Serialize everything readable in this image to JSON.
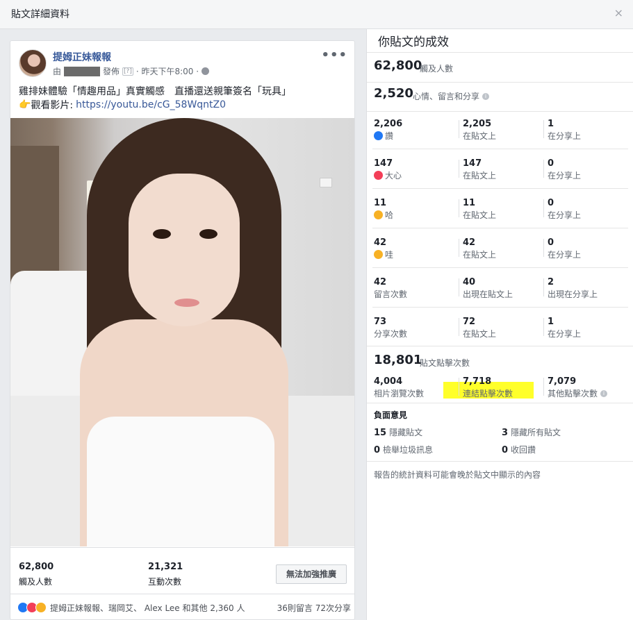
{
  "dialog": {
    "title": "貼文詳細資料",
    "close": "×"
  },
  "post": {
    "page_name": "提姆正妹報報",
    "meta": {
      "prefix": "由",
      "published": "發佈",
      "help": "[?]",
      "time": "· 昨天下午8:00 ·"
    },
    "more": "•••",
    "text_line1": "雞排妹體驗「情趣用品」真實觸感　直播還送親筆簽名「玩具」",
    "text_line2_prefix": "觀看影片: ",
    "text_line2_link": "https://youtu.be/cG_58WqntZ0",
    "reach_value": "62,800",
    "reach_label": "觸及人數",
    "engagement_value": "21,321",
    "engagement_label": "互動次數",
    "boost_button": "無法加強推廣",
    "reactions_names": "提姆正妹報報、瑞岡艾、 Alex Lee 和其他 2,360 人",
    "comments_shares": "36則留言  72次分享"
  },
  "performance": {
    "title": "你貼文的成效",
    "reach": {
      "value": "62,800",
      "label": "觸及人數"
    },
    "engagement": {
      "value": "2,520",
      "label": "心情、留言和分享"
    },
    "rows": [
      {
        "total": "2,206",
        "label": "讚",
        "icon": "like-icon",
        "on_post": "2,205",
        "on_post_label": "在貼文上",
        "on_shares": "1",
        "on_shares_label": "在分享上"
      },
      {
        "total": "147",
        "label": "大心",
        "icon": "love-icon",
        "on_post": "147",
        "on_post_label": "在貼文上",
        "on_shares": "0",
        "on_shares_label": "在分享上"
      },
      {
        "total": "11",
        "label": "哈",
        "icon": "haha-icon",
        "on_post": "11",
        "on_post_label": "在貼文上",
        "on_shares": "0",
        "on_shares_label": "在分享上"
      },
      {
        "total": "42",
        "label": "哇",
        "icon": "wow-icon",
        "on_post": "42",
        "on_post_label": "在貼文上",
        "on_shares": "0",
        "on_shares_label": "在分享上"
      },
      {
        "total": "42",
        "label": "留言次數",
        "icon": "",
        "on_post": "40",
        "on_post_label": "出現在貼文上",
        "on_shares": "2",
        "on_shares_label": "出現在分享上"
      },
      {
        "total": "73",
        "label": "分享次數",
        "icon": "",
        "on_post": "72",
        "on_post_label": "在貼文上",
        "on_shares": "1",
        "on_shares_label": "在分享上"
      }
    ],
    "clicks": {
      "value": "18,801",
      "label": "貼文點擊次數",
      "photo_views": {
        "value": "4,004",
        "label": "相片瀏覽次數"
      },
      "link_clicks": {
        "value": "7,718",
        "label": "連結點擊次數"
      },
      "other_clicks": {
        "value": "7,079",
        "label": "其他點擊次數"
      }
    },
    "negative": {
      "title": "負面意見",
      "hide_post": {
        "value": "15",
        "label": "隱藏貼文"
      },
      "hide_all": {
        "value": "3",
        "label": "隱藏所有貼文"
      },
      "report_spam": {
        "value": "0",
        "label": "檢舉垃圾訊息"
      },
      "unlike": {
        "value": "0",
        "label": "收回讚"
      }
    },
    "footnote": "報告的統計資料可能會晚於貼文中顯示的內容"
  },
  "colors": {
    "link": "#365899",
    "highlight": "#ffff2a",
    "like": "#2078f4",
    "love": "#f33e58",
    "haha": "#f7b125"
  }
}
